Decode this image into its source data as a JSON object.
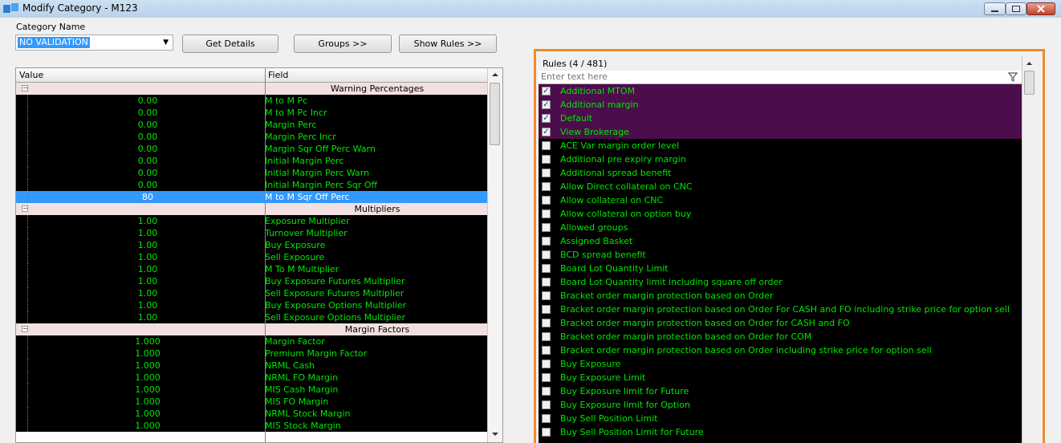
{
  "window": {
    "title": "Modify Category - M123"
  },
  "category": {
    "label": "Category Name",
    "selected": "NO VALIDATION",
    "buttons": {
      "get_details": "Get Details",
      "groups": "Groups >>",
      "show_rules": "Show Rules >>"
    }
  },
  "grid": {
    "columns": {
      "value": "Value",
      "field": "Field"
    },
    "rows": [
      {
        "group": "Warning Percentages"
      },
      {
        "value": "0.00",
        "field": "M to M Pc"
      },
      {
        "value": "0.00",
        "field": "M to M Pc Incr"
      },
      {
        "value": "0.00",
        "field": "Margin Perc"
      },
      {
        "value": "0.00",
        "field": "Margin Perc Incr"
      },
      {
        "value": "0.00",
        "field": "Margin Sqr Off Perc Warn"
      },
      {
        "value": "0.00",
        "field": "Initial Margin Perc"
      },
      {
        "value": "0.00",
        "field": "Initial Margin Perc Warn"
      },
      {
        "value": "0.00",
        "field": "Initial Margin Perc Sqr Off"
      },
      {
        "value": "80",
        "field": "M to M Sqr Off Perc",
        "selected": true
      },
      {
        "group": "Multipliers"
      },
      {
        "value": "1.00",
        "field": "Exposure Multiplier"
      },
      {
        "value": "1.00",
        "field": "Turnover Multiplier"
      },
      {
        "value": "1.00",
        "field": "Buy Exposure"
      },
      {
        "value": "1.00",
        "field": "Sell Exposure"
      },
      {
        "value": "1.00",
        "field": "M To M Multiplier"
      },
      {
        "value": "1.00",
        "field": "Buy Exposure Futures Multiplier"
      },
      {
        "value": "1.00",
        "field": "Sell Exposure Futures Multiplier"
      },
      {
        "value": "1.00",
        "field": "Buy Exposure Options Multiplier"
      },
      {
        "value": "1.00",
        "field": "Sell Exposure Options Multiplier"
      },
      {
        "group": "Margin Factors"
      },
      {
        "value": "1.000",
        "field": "Margin Factor"
      },
      {
        "value": "1.000",
        "field": "Premium Margin Factor"
      },
      {
        "value": "1.000",
        "field": "NRML Cash"
      },
      {
        "value": "1.000",
        "field": "NRML FO Margin"
      },
      {
        "value": "1.000",
        "field": "MIS Cash Margin"
      },
      {
        "value": "1.000",
        "field": "MIS FO Margin"
      },
      {
        "value": "1.000",
        "field": "NRML Stock Margin"
      },
      {
        "value": "1.000",
        "field": "MIS Stock Margin"
      }
    ]
  },
  "rules": {
    "header": "Rules (4 / 481)",
    "filter_placeholder": "Enter text here",
    "items": [
      {
        "label": "Additional MTOM",
        "checked": true
      },
      {
        "label": "Additional margin",
        "checked": true
      },
      {
        "label": "Default",
        "checked": true
      },
      {
        "label": "View Brokerage",
        "checked": true
      },
      {
        "label": "ACE Var margin order level",
        "checked": false
      },
      {
        "label": "Additional pre expiry margin",
        "checked": false
      },
      {
        "label": "Additional spread benefit",
        "checked": false
      },
      {
        "label": "Allow Direct collateral on CNC",
        "checked": false
      },
      {
        "label": "Allow collateral on CNC",
        "checked": false
      },
      {
        "label": "Allow collateral on option buy",
        "checked": false
      },
      {
        "label": "Allowed groups",
        "checked": false
      },
      {
        "label": "Assigned Basket",
        "checked": false
      },
      {
        "label": "BCD spread benefit",
        "checked": false
      },
      {
        "label": "Board Lot Quantity Limit",
        "checked": false
      },
      {
        "label": "Board Lot Quantity limit including square off order",
        "checked": false
      },
      {
        "label": "Bracket order margin protection based on Order",
        "checked": false
      },
      {
        "label": "Bracket order margin protection based on Order For CASH and FO including strike price for option sell",
        "checked": false
      },
      {
        "label": "Bracket order margin protection based on Order for CASH and FO",
        "checked": false
      },
      {
        "label": "Bracket order margin protection based on Order for COM",
        "checked": false
      },
      {
        "label": "Bracket order margin protection based on Order including strike price for option sell",
        "checked": false
      },
      {
        "label": "Buy Exposure",
        "checked": false
      },
      {
        "label": "Buy Exposure Limit",
        "checked": false
      },
      {
        "label": "Buy Exposure limit for Future",
        "checked": false
      },
      {
        "label": "Buy Exposure limit for Option",
        "checked": false
      },
      {
        "label": "Buy Sell Position Limit",
        "checked": false
      },
      {
        "label": "Buy Sell Position Limit for Future",
        "checked": false
      }
    ]
  },
  "colors": {
    "data_text": "#00e600",
    "selection": "#3399ff",
    "checked_row": "#4b0d4b",
    "panel_border": "#ee8a2c",
    "group_row": "#f2e0e0"
  },
  "icons": [
    "app-icon",
    "dropdown-arrow-icon",
    "minimize-icon",
    "maximize-icon",
    "close-icon",
    "filter-icon",
    "scroll-up-icon",
    "scroll-down-icon",
    "collapse-icon"
  ]
}
